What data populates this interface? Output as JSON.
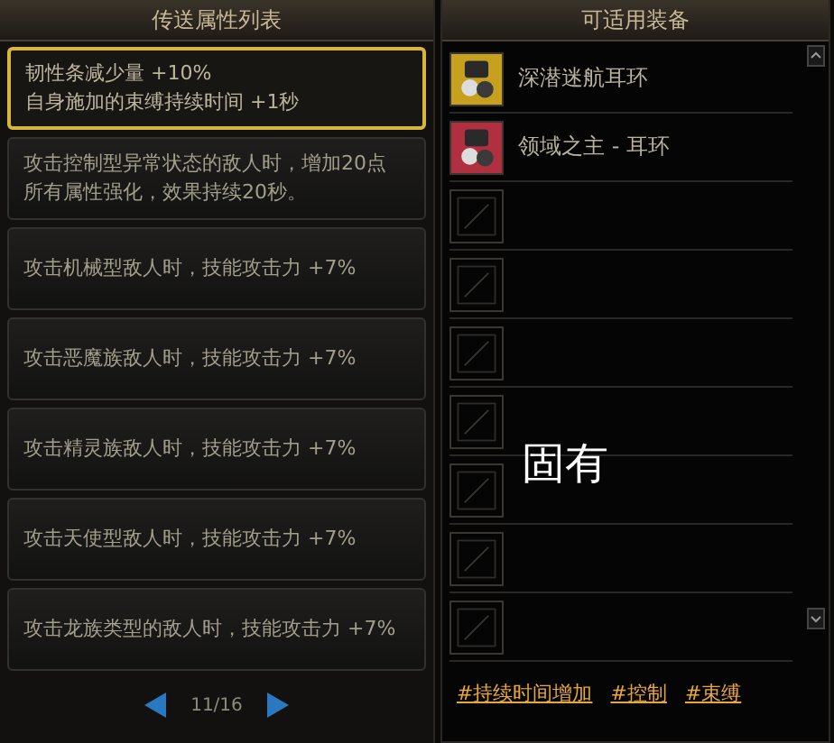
{
  "attribute_panel": {
    "title": "传送属性列表",
    "items": [
      {
        "lines": [
          "韧性条减少量 +10%",
          "自身施加的束缚持续时间 +1秒"
        ],
        "selected": true
      },
      {
        "lines": [
          "攻击控制型异常状态的敌人时，增加20点",
          "所有属性强化，效果持续20秒。"
        ],
        "selected": false
      },
      {
        "lines": [
          "攻击机械型敌人时，技能攻击力 +7%"
        ],
        "selected": false
      },
      {
        "lines": [
          "攻击恶魔族敌人时，技能攻击力 +7%"
        ],
        "selected": false
      },
      {
        "lines": [
          "攻击精灵族敌人时，技能攻击力 +7%"
        ],
        "selected": false
      },
      {
        "lines": [
          "攻击天使型敌人时，技能攻击力 +7%"
        ],
        "selected": false
      },
      {
        "lines": [
          "攻击龙族类型的敌人时，技能攻击力 +7%"
        ],
        "selected": false
      }
    ],
    "pagination": {
      "page": "11/16"
    }
  },
  "equipment_panel": {
    "title": "可适用装备",
    "slots": [
      {
        "kind": "item",
        "name": "深潜迷航耳环",
        "color": "#c8a020"
      },
      {
        "kind": "item",
        "name": "领域之主 - 耳环",
        "color": "#b03040"
      },
      {
        "kind": "empty"
      },
      {
        "kind": "empty"
      },
      {
        "kind": "empty"
      },
      {
        "kind": "empty"
      },
      {
        "kind": "empty"
      },
      {
        "kind": "empty"
      },
      {
        "kind": "empty"
      }
    ],
    "overlay_label": "固有",
    "tags": [
      "#持续时间增加",
      "#控制",
      "#束缚"
    ]
  }
}
